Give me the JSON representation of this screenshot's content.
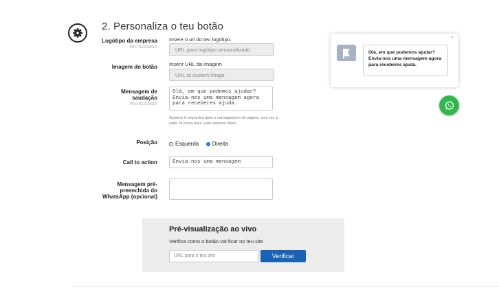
{
  "section": {
    "title": "2. Personaliza o teu botão",
    "icon": "gear-icon"
  },
  "logo": {
    "label": "Logótipo da empresa",
    "pro": "PRO RECURSO",
    "caption": "Insere o url do teu logótipo.",
    "placeholder": "URL para logótipo personalizado"
  },
  "button_image": {
    "label": "Imagem do botão",
    "caption": "Inserir URL da imagem",
    "placeholder": "URL to custom image"
  },
  "greeting": {
    "label": "Mensagem de saudação",
    "pro": "PRO RECURSO",
    "value": "Olá, em que podemos ajudar? Envia-nos uma mensagem agora para receberes ajuda.",
    "help": "Aparece 5 segundos após o carregamento da página, uma vez a cada 24 horas para cada visitante único"
  },
  "position": {
    "label": "Posição",
    "options": [
      "Esquerda",
      "Direita"
    ],
    "selected": "Direita"
  },
  "cta": {
    "label": "Call to action",
    "value": "Envia-nos uma mensagem"
  },
  "prefilled": {
    "label": "Mensagem pré-preenchida do WhatsApp (opcional)",
    "value": ""
  },
  "preview": {
    "close": "×",
    "message": "Olá, em que podemos ajudar? Envia-nos uma mensagem agora para receberes ajuda.",
    "whatsapp_color": "#2fb94a"
  },
  "live": {
    "title": "Pré-visualização ao vivo",
    "subtitle": "Verifica como o botão vai ficar no teu site",
    "placeholder": "URL para o teu site",
    "button": "Verificar",
    "button_color": "#1a62b5"
  }
}
